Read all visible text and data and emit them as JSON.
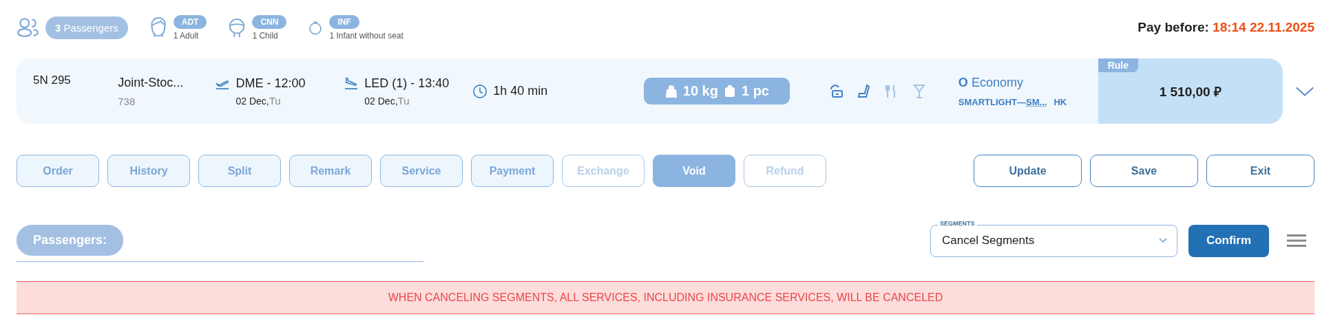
{
  "passengers": {
    "count": "3",
    "label": "Passengers"
  },
  "passenger_types": [
    {
      "kind": "adult",
      "code": "ADT",
      "text": "1 Adult"
    },
    {
      "kind": "child",
      "code": "CNN",
      "text": "1 Child"
    },
    {
      "kind": "infant",
      "code": "INF",
      "text": "1 Infant without seat"
    }
  ],
  "pay_before": {
    "label": "Pay before:",
    "value": "18:14 22.11.2025"
  },
  "flight": {
    "number": "5N 295",
    "airline": "Joint-Stoc...",
    "aircraft": "738",
    "departure": {
      "place": "DME - 12:00",
      "date": "02 Dec,",
      "weekday": "Tu"
    },
    "arrival": {
      "place": "LED (1) - 13:40",
      "date": "02 Dec,",
      "weekday": "Tu"
    },
    "duration": "1h 40 min",
    "baggage": {
      "weight": "10 kg",
      "pieces": "1 pc"
    },
    "amenities": [
      {
        "kind": "refund",
        "available": true
      },
      {
        "kind": "seat",
        "available": true
      },
      {
        "kind": "meal",
        "available": false
      },
      {
        "kind": "drink",
        "available": false
      }
    ],
    "class_code": "O",
    "cabin": "Economy",
    "fare": "SMARTLIGHT—",
    "fare_code": "SM...",
    "status": "HK",
    "rule": "Rule",
    "price": "1 510,00 ₽"
  },
  "tabs": [
    {
      "label": "Order",
      "selected": false,
      "disabled": false
    },
    {
      "label": "History",
      "selected": false,
      "disabled": false
    },
    {
      "label": "Split",
      "selected": false,
      "disabled": false
    },
    {
      "label": "Remark",
      "selected": false,
      "disabled": false
    },
    {
      "label": "Service",
      "selected": false,
      "disabled": false
    },
    {
      "label": "Payment",
      "selected": false,
      "disabled": false
    },
    {
      "label": "Exchange",
      "selected": false,
      "disabled": true
    },
    {
      "label": "Void",
      "selected": true,
      "disabled": false
    },
    {
      "label": "Refund",
      "selected": false,
      "disabled": true
    }
  ],
  "actions": [
    "Update",
    "Save",
    "Exit"
  ],
  "passengers_section": {
    "label": "Passengers:"
  },
  "segments": {
    "label": "SEGMENTS",
    "value": "Cancel Segments"
  },
  "confirm": "Confirm",
  "warning": "WHEN CANCELING SEGMENTS, ALL SERVICES, INCLUDING INSURANCE SERVICES, WILL BE CANCELED"
}
